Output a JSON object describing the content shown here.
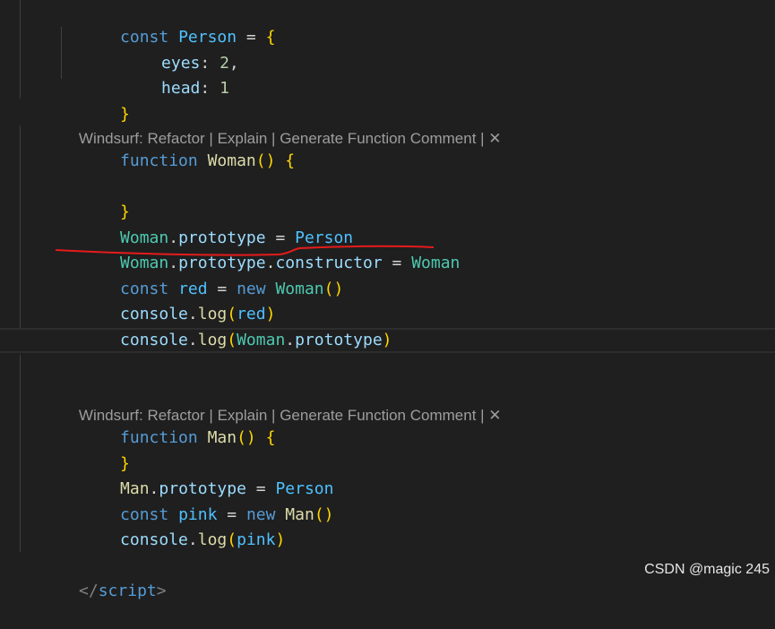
{
  "code": {
    "person_kw": "const",
    "person_name": "Person",
    "person_eq": " = ",
    "person_open": "{",
    "eyes_key": "eyes",
    "eyes_colon": ": ",
    "eyes_val": "2",
    "eyes_comma": ",",
    "head_key": "head",
    "head_colon": ": ",
    "head_val": "1",
    "person_close": "}",
    "woman_fn_kw": "function",
    "woman_fn_name": "Woman",
    "woman_parens": "()",
    "woman_open": "{",
    "woman_close": "}",
    "l1_a": "Woman",
    "l1_dot": ".",
    "l1_b": "prototype",
    "l1_eq": " = ",
    "l1_c": "Person",
    "l2_a": "Woman",
    "l2_dot1": ".",
    "l2_b": "prototype",
    "l2_dot2": ".",
    "l2_c": "constructor",
    "l2_eq": " = ",
    "l2_d": "Woman",
    "l3_kw": "const",
    "l3_var": "red",
    "l3_eq": " = ",
    "l3_new": "new",
    "l3_cls": "Woman",
    "l3_parens": "()",
    "l4_obj": "console",
    "l4_dot": ".",
    "l4_fn": "log",
    "l4_open": "(",
    "l4_arg": "red",
    "l4_close": ")",
    "l5_obj": "console",
    "l5_dot": ".",
    "l5_fn": "log",
    "l5_open": "(",
    "l5_arg1": "Woman",
    "l5_dot2": ".",
    "l5_arg2": "prototype",
    "l5_close": ")",
    "man_fn_kw": "function",
    "man_fn_name": "Man",
    "man_parens": "()",
    "man_open": "{",
    "man_close": "}",
    "m1_a": "Man",
    "m1_dot": ".",
    "m1_b": "prototype",
    "m1_eq": " = ",
    "m1_c": "Person",
    "m2_kw": "const",
    "m2_var": "pink",
    "m2_eq": " = ",
    "m2_new": "new",
    "m2_cls": "Man",
    "m2_parens": "()",
    "m3_obj": "console",
    "m3_dot": ".",
    "m3_fn": "log",
    "m3_open": "(",
    "m3_arg": "pink",
    "m3_close": ")",
    "script_open": "</",
    "script_name": "script",
    "script_close": ">"
  },
  "codelens": {
    "prefix": "Windsurf: ",
    "refactor": "Refactor",
    "sep": " | ",
    "explain": "Explain",
    "generate": "Generate Function Comment",
    "close": "✕"
  },
  "watermark": "CSDN @magic 245",
  "colors": {
    "background": "#1f1f1f",
    "keyword": "#569cd6",
    "class": "#4ec9b0",
    "variable": "#4fc1ff",
    "function": "#dcdcaa",
    "property": "#9cdcfe",
    "number": "#b5cea8",
    "bracket": "#ffd700",
    "annotation_underline": "#e51b1b"
  }
}
